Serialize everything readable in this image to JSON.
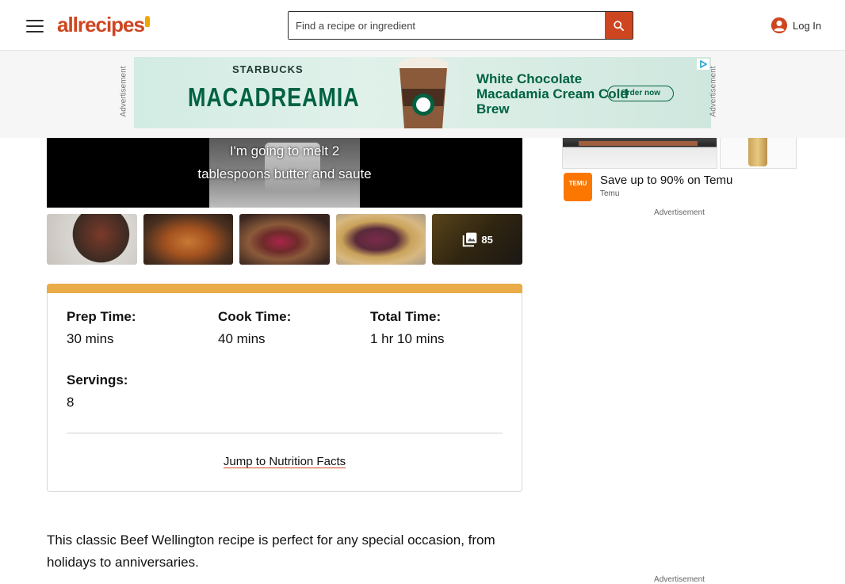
{
  "header": {
    "logo": "allrecipes",
    "search_placeholder": "Find a recipe or ingredient",
    "login_label": "Log In"
  },
  "ad_banner": {
    "side_label": "Advertisement",
    "brand": "STARBUCKS",
    "title": "MACADREAMIA",
    "description": "White Chocolate Macadamia Cream Cold Brew",
    "cta": "Order now"
  },
  "video": {
    "caption_line1": "I'm going to melt 2",
    "caption_line2": "tablespoons butter and saute"
  },
  "thumbnails": {
    "photo_count": "85"
  },
  "details": {
    "prep_label": "Prep Time:",
    "prep_value": "30 mins",
    "cook_label": "Cook Time:",
    "cook_value": "40 mins",
    "total_label": "Total Time:",
    "total_value": "1 hr 10 mins",
    "servings_label": "Servings:",
    "servings_value": "8",
    "jump_link": "Jump to Nutrition Facts",
    "accent_color": "#e9ac48"
  },
  "description": "This classic Beef Wellington recipe is perfect for any special occasion, from holidays to anniversaries.",
  "rail_ad": {
    "brand_badge": "TEMU",
    "headline": "Save up to 90% on Temu",
    "source": "Temu",
    "label": "Advertisement",
    "label_bottom": "Advertisement"
  },
  "colors": {
    "brand": "#ce4620",
    "accent": "#e9ac48"
  }
}
